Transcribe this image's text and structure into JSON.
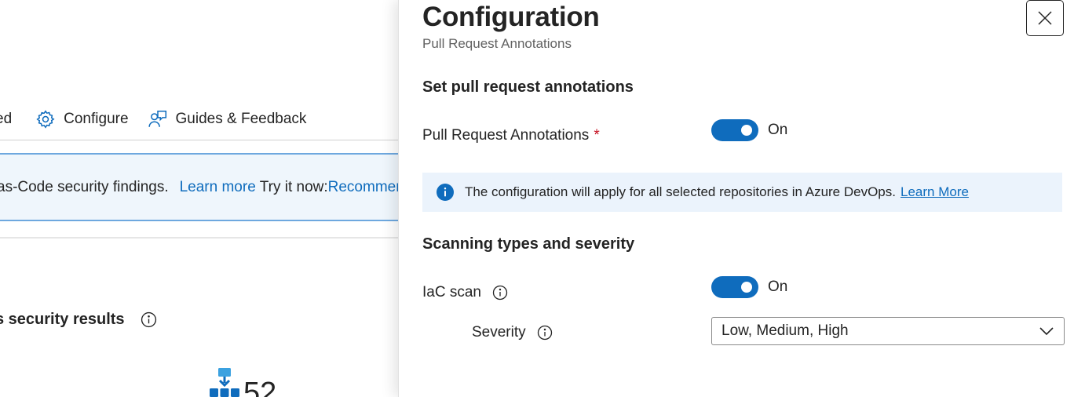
{
  "background": {
    "command_bar": {
      "partial_item_label": "ed",
      "configure_label": "Configure",
      "guides_label": "Guides & Feedback"
    },
    "banner": {
      "text": "as-Code security findings.",
      "learn_more": "Learn more",
      "try_it_now": "Try it now:",
      "recommend_link": "Recommend"
    },
    "section_heading": "s security results",
    "metric_value": "52"
  },
  "panel": {
    "title": "Configuration",
    "subtitle": "Pull Request Annotations",
    "section1_heading": "Set pull request annotations",
    "pr_annotations": {
      "label": "Pull Request Annotations",
      "required_marker": "*",
      "state": "On",
      "enabled": true
    },
    "info_message": {
      "text": "The configuration will apply for all selected repositories in Azure DevOps.",
      "link": "Learn More"
    },
    "section2_heading": "Scanning types and severity",
    "iac_scan": {
      "label": "IaC scan",
      "state": "On",
      "enabled": true
    },
    "severity": {
      "label": "Severity",
      "selected_value": "Low, Medium, High"
    }
  },
  "colors": {
    "accent": "#0f6cbd",
    "required": "#c50f1f",
    "banner_bg": "#eff6fc",
    "banner_border": "#6ea8df",
    "message_bg": "#ebf3fc"
  },
  "icons": [
    "gear-icon",
    "feedback-person-icon",
    "info-icon",
    "pipeline-icon",
    "close-icon",
    "chevron-down-icon"
  ]
}
